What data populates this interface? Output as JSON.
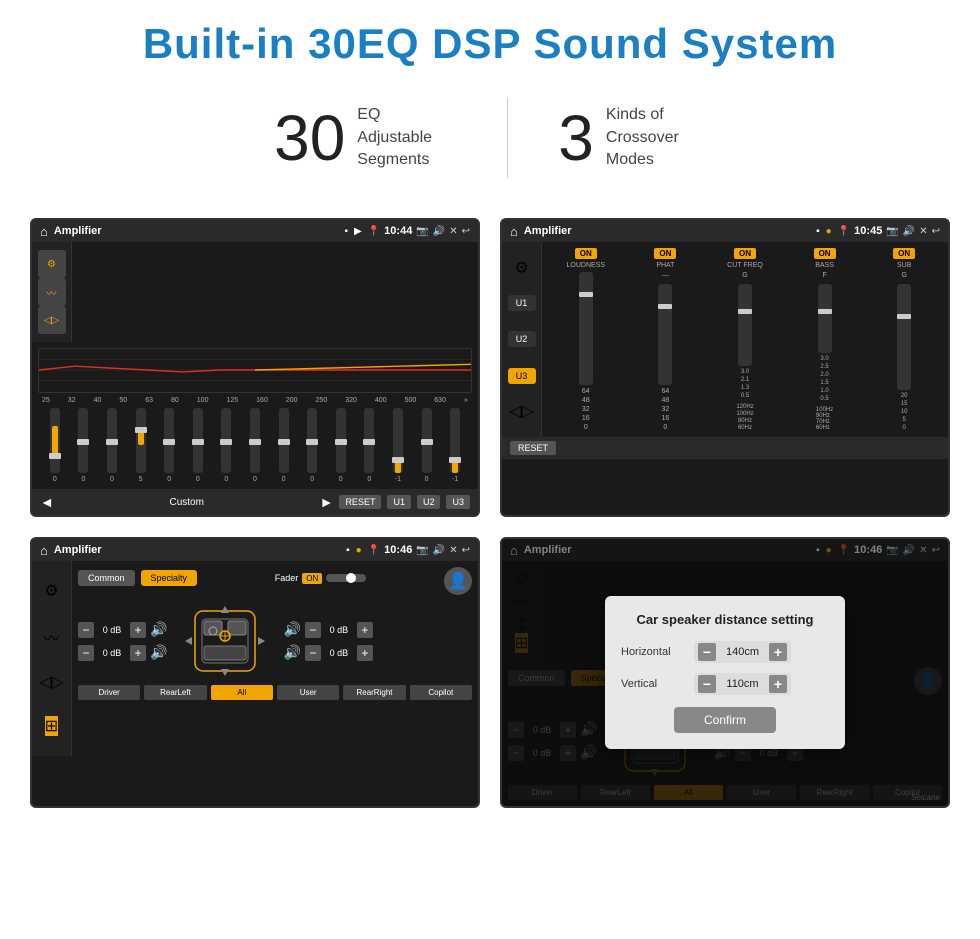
{
  "header": {
    "title": "Built-in 30EQ DSP Sound System"
  },
  "stats": [
    {
      "number": "30",
      "label": "EQ Adjustable\nSegments"
    },
    {
      "number": "3",
      "label": "Kinds of\nCrossover Modes"
    }
  ],
  "screens": {
    "eq": {
      "status": {
        "title": "Amplifier",
        "time": "10:44"
      },
      "freq_labels": [
        "25",
        "32",
        "40",
        "50",
        "63",
        "80",
        "100",
        "125",
        "160",
        "200",
        "250",
        "320",
        "400",
        "500",
        "630"
      ],
      "slider_values": [
        "0",
        "0",
        "0",
        "0",
        "5",
        "0",
        "0",
        "0",
        "0",
        "0",
        "0",
        "0",
        "0",
        "-1",
        "0",
        "-1"
      ],
      "bottom_buttons": [
        "RESET",
        "U1",
        "U2",
        "U3"
      ],
      "bottom_label": "Custom"
    },
    "crossover": {
      "status": {
        "title": "Amplifier",
        "time": "10:45"
      },
      "channels": [
        "LOUDNESS",
        "PHAT",
        "CUT FREQ",
        "BASS",
        "SUB"
      ],
      "u_buttons": [
        "U1",
        "U2",
        "U3"
      ],
      "active_u": "U3",
      "reset_label": "RESET"
    },
    "speaker": {
      "status": {
        "title": "Amplifier",
        "time": "10:46"
      },
      "tabs": [
        "Common",
        "Specialty"
      ],
      "active_tab": "Specialty",
      "fader_label": "Fader",
      "fader_on": "ON",
      "db_values": [
        "0 dB",
        "0 dB",
        "0 dB",
        "0 dB"
      ],
      "buttons": [
        "Driver",
        "RearLeft",
        "All",
        "User",
        "RearRight",
        "Copilot"
      ]
    },
    "distance": {
      "status": {
        "title": "Amplifier",
        "time": "10:46"
      },
      "dialog": {
        "title": "Car speaker distance setting",
        "horizontal_label": "Horizontal",
        "horizontal_value": "140cm",
        "vertical_label": "Vertical",
        "vertical_value": "110cm",
        "confirm_label": "Confirm"
      },
      "tabs": [
        "Common",
        "Specialty"
      ],
      "active_tab": "Specialty"
    }
  },
  "watermark": "Seicane"
}
